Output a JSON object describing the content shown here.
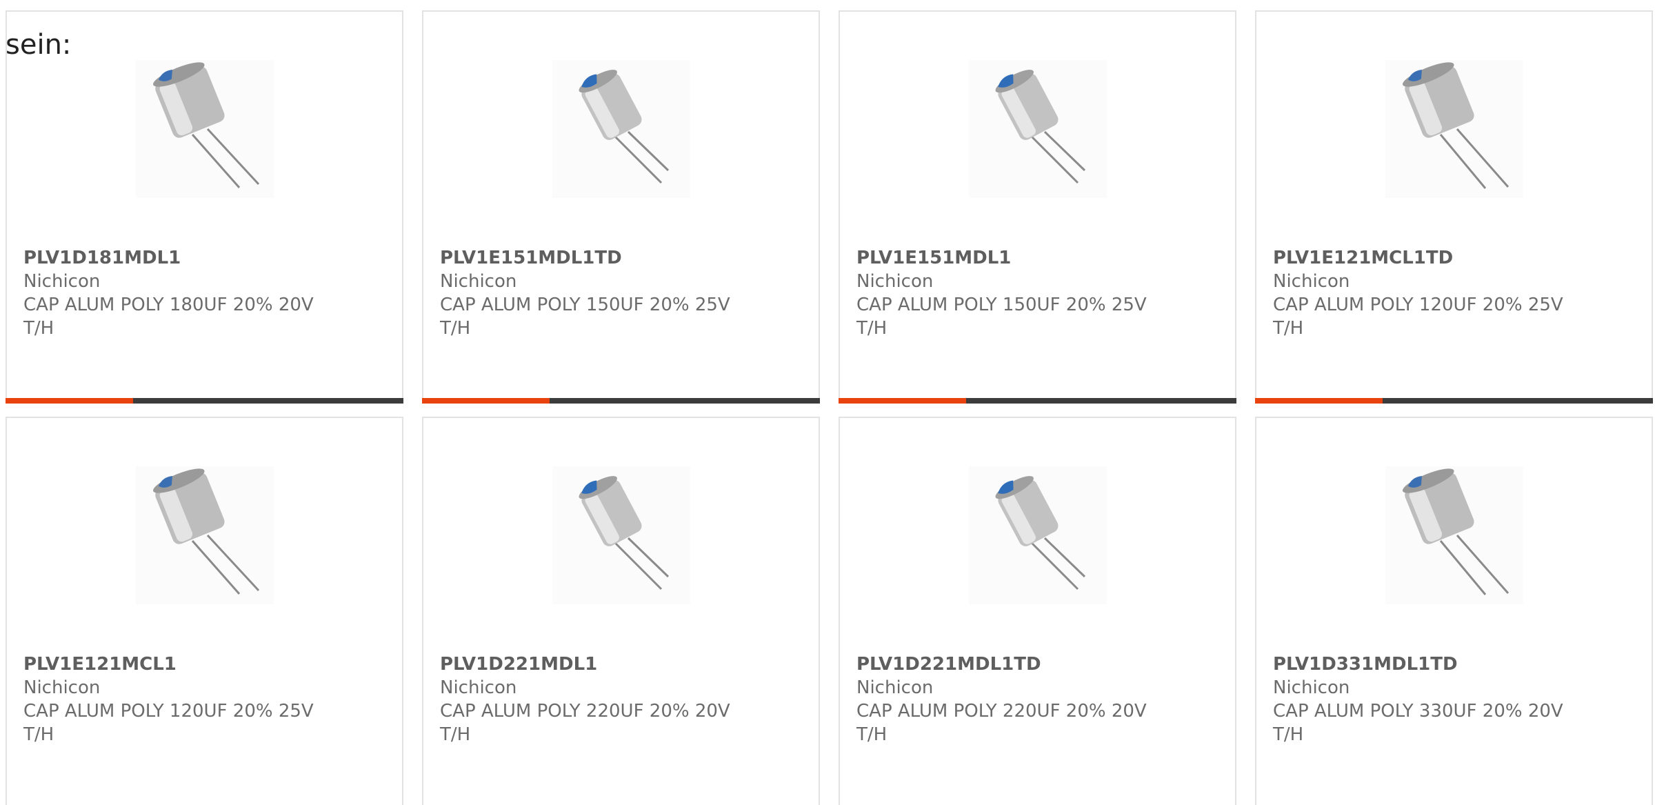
{
  "lead_text": "sein:",
  "colors": {
    "accent": "#e8430f",
    "track": "#3c3c3c",
    "border": "#e2e2e2",
    "text": "#6b6b6b"
  },
  "cards": [
    {
      "part_number": "PLV1D181MDL1",
      "manufacturer": "Nichicon",
      "description": "CAP ALUM POLY 180UF 20% 20V",
      "mount": "T/H",
      "progress": 0.32
    },
    {
      "part_number": "PLV1E151MDL1TD",
      "manufacturer": "Nichicon",
      "description": "CAP ALUM POLY 150UF 20% 25V",
      "mount": "T/H",
      "progress": 0.32
    },
    {
      "part_number": "PLV1E151MDL1",
      "manufacturer": "Nichicon",
      "description": "CAP ALUM POLY 150UF 20% 25V",
      "mount": "T/H",
      "progress": 0.32
    },
    {
      "part_number": "PLV1E121MCL1TD",
      "manufacturer": "Nichicon",
      "description": "CAP ALUM POLY 120UF 20% 25V",
      "mount": "T/H",
      "progress": 0.32
    },
    {
      "part_number": "PLV1E121MCL1",
      "manufacturer": "Nichicon",
      "description": "CAP ALUM POLY 120UF 20% 25V",
      "mount": "T/H"
    },
    {
      "part_number": "PLV1D221MDL1",
      "manufacturer": "Nichicon",
      "description": "CAP ALUM POLY 220UF 20% 20V",
      "mount": "T/H"
    },
    {
      "part_number": "PLV1D221MDL1TD",
      "manufacturer": "Nichicon",
      "description": "CAP ALUM POLY 220UF 20% 20V",
      "mount": "T/H"
    },
    {
      "part_number": "PLV1D331MDL1TD",
      "manufacturer": "Nichicon",
      "description": "CAP ALUM POLY 330UF 20% 20V",
      "mount": "T/H"
    }
  ]
}
